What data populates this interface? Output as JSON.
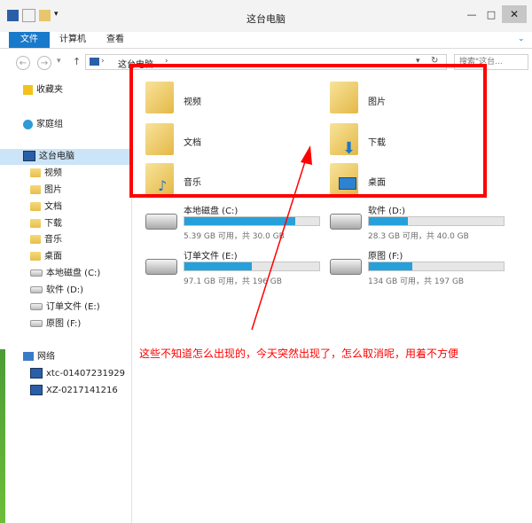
{
  "window": {
    "title": "这台电脑"
  },
  "ribbon": {
    "tabs": [
      "文件",
      "计算机",
      "查看"
    ]
  },
  "address": {
    "path": "这台电脑",
    "search_placeholder": "搜索\"这台..."
  },
  "nav": {
    "favorites": "收藏夹",
    "homegroup": "家庭组",
    "this_pc": "这台电脑",
    "items": [
      "视频",
      "图片",
      "文档",
      "下载",
      "音乐",
      "桌面",
      "本地磁盘 (C:)",
      "软件 (D:)",
      "订单文件 (E:)",
      "原图 (F:)"
    ],
    "network": "网络",
    "network_items": [
      "xtc-01407231929",
      "XZ-0217141216"
    ]
  },
  "folders": [
    {
      "label": "视频",
      "icon": "video-folder-icon"
    },
    {
      "label": "图片",
      "icon": "picture-folder-icon"
    },
    {
      "label": "文档",
      "icon": "document-folder-icon"
    },
    {
      "label": "下载",
      "icon": "download-folder-icon"
    },
    {
      "label": "音乐",
      "icon": "music-folder-icon"
    },
    {
      "label": "桌面",
      "icon": "desktop-folder-icon"
    }
  ],
  "drives": [
    {
      "name": "本地磁盘 (C:)",
      "info": "5.39 GB 可用，共 30.0 GB",
      "used_fraction": 0.82
    },
    {
      "name": "软件 (D:)",
      "info": "28.3 GB 可用，共 40.0 GB",
      "used_fraction": 0.29
    },
    {
      "name": "订单文件 (E:)",
      "info": "97.1 GB 可用，共 196 GB",
      "used_fraction": 0.5
    },
    {
      "name": "原图 (F:)",
      "info": "134 GB 可用，共 197 GB",
      "used_fraction": 0.32
    }
  ],
  "annotation": {
    "text": "这些不知道怎么出现的，今天突然出现了，怎么取消呢，用着不方便"
  },
  "colors": {
    "accent": "#1979ca",
    "highlight": "#ff0000",
    "bar": "#26a0da"
  }
}
